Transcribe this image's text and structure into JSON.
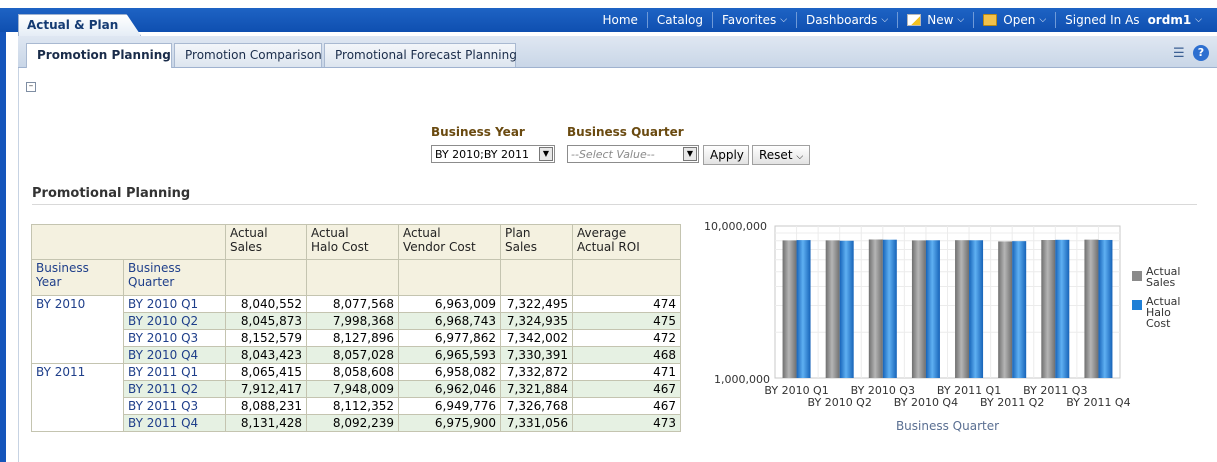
{
  "app_tab": "Actual & Plan",
  "global_nav": {
    "home": "Home",
    "catalog": "Catalog",
    "favorites": "Favorites",
    "dashboards": "Dashboards",
    "new": "New",
    "open": "Open",
    "signed_in_label": "Signed In As",
    "user": "ordm1"
  },
  "tabs": [
    {
      "label": "Promotion Planning",
      "active": true
    },
    {
      "label": "Promotion Comparison",
      "active": false
    },
    {
      "label": "Promotional Forecast Planning",
      "active": false
    }
  ],
  "prompts": {
    "year_label": "Business Year",
    "year_value": "BY 2010;BY 2011",
    "quarter_label": "Business Quarter",
    "quarter_placeholder": "--Select Value--",
    "apply": "Apply",
    "reset": "Reset"
  },
  "section_title": "Promotional Planning",
  "table": {
    "col_headers": [
      [
        "Actual",
        "Sales"
      ],
      [
        "Actual",
        "Halo Cost"
      ],
      [
        "Actual",
        "Vendor Cost"
      ],
      [
        "Plan",
        "Sales"
      ],
      [
        "Average",
        "Actual ROI"
      ]
    ],
    "row_headers": [
      [
        "Business",
        "Year"
      ],
      [
        "Business",
        "Quarter"
      ]
    ],
    "groups": [
      {
        "year": "BY 2010",
        "rows": [
          {
            "quarter": "BY 2010 Q1",
            "values": [
              "8,040,552",
              "8,077,568",
              "6,963,009",
              "7,322,495",
              "474"
            ]
          },
          {
            "quarter": "BY 2010 Q2",
            "values": [
              "8,045,873",
              "7,998,368",
              "6,968,743",
              "7,324,935",
              "475"
            ]
          },
          {
            "quarter": "BY 2010 Q3",
            "values": [
              "8,152,579",
              "8,127,896",
              "6,977,862",
              "7,342,002",
              "472"
            ]
          },
          {
            "quarter": "BY 2010 Q4",
            "values": [
              "8,043,423",
              "8,057,028",
              "6,965,593",
              "7,330,391",
              "468"
            ]
          }
        ]
      },
      {
        "year": "BY 2011",
        "rows": [
          {
            "quarter": "BY 2011 Q1",
            "values": [
              "8,065,415",
              "8,058,608",
              "6,958,082",
              "7,332,872",
              "471"
            ]
          },
          {
            "quarter": "BY 2011 Q2",
            "values": [
              "7,912,417",
              "7,948,009",
              "6,962,046",
              "7,321,884",
              "467"
            ]
          },
          {
            "quarter": "BY 2011 Q3",
            "values": [
              "8,088,231",
              "8,112,352",
              "6,949,776",
              "7,326,768",
              "467"
            ]
          },
          {
            "quarter": "BY 2011 Q4",
            "values": [
              "8,131,428",
              "8,092,239",
              "6,975,900",
              "7,331,056",
              "473"
            ]
          }
        ]
      }
    ]
  },
  "chart_data": {
    "type": "bar",
    "y_scale": "log",
    "ylim": [
      1000000,
      10000000
    ],
    "y_ticks": [
      "10,000,000",
      "1,000,000"
    ],
    "xlabel": "Business Quarter",
    "categories": [
      "BY 2010 Q1",
      "BY 2010 Q2",
      "BY 2010 Q3",
      "BY 2010 Q4",
      "BY 2011 Q1",
      "BY 2011 Q2",
      "BY 2011 Q3",
      "BY 2011 Q4"
    ],
    "series": [
      {
        "name": "Actual Sales",
        "color": "#8a8a8a",
        "values": [
          8040552,
          8045873,
          8152579,
          8043423,
          8065415,
          7912417,
          8088231,
          8131428
        ]
      },
      {
        "name": "Actual Halo Cost",
        "color": "#1f7fd6",
        "values": [
          8077568,
          7998368,
          8127896,
          8057028,
          8058608,
          7948009,
          8112352,
          8092239
        ]
      }
    ],
    "legend_position": "right",
    "grid": true
  }
}
